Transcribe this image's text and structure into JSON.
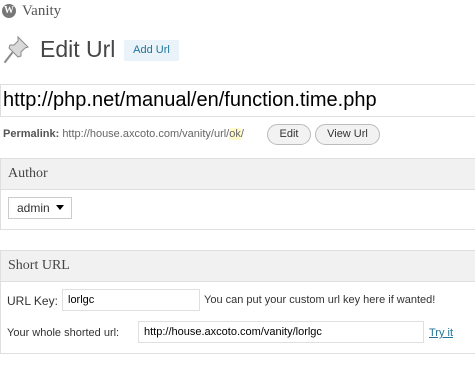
{
  "topbar": {
    "site_title": "Vanity",
    "logo_glyph": "W"
  },
  "header": {
    "title": "Edit Url",
    "add_button": "Add Url"
  },
  "title_field": {
    "value": "http://php.net/manual/en/function.time.php"
  },
  "permalink": {
    "label": "Permalink:",
    "base_url": "http://house.axcoto.com/vanity/url/",
    "slug": "ok",
    "trailing": "/",
    "edit_button": "Edit",
    "view_button": "View Url"
  },
  "author_box": {
    "heading": "Author",
    "selected": "admin"
  },
  "short_url_box": {
    "heading": "Short URL",
    "url_key_label": "URL Key:",
    "url_key_value": "lorlgc",
    "url_key_hint": "You can put your custom url key here if wanted!",
    "whole_url_label": "Your whole shorted url:",
    "whole_url_value": "http://house.axcoto.com/vanity/lorlgc",
    "try_link": "Try it"
  },
  "colors": {
    "link": "#21759b",
    "box_border": "#dfdfdf",
    "slug_highlight": "#fffbcc"
  }
}
